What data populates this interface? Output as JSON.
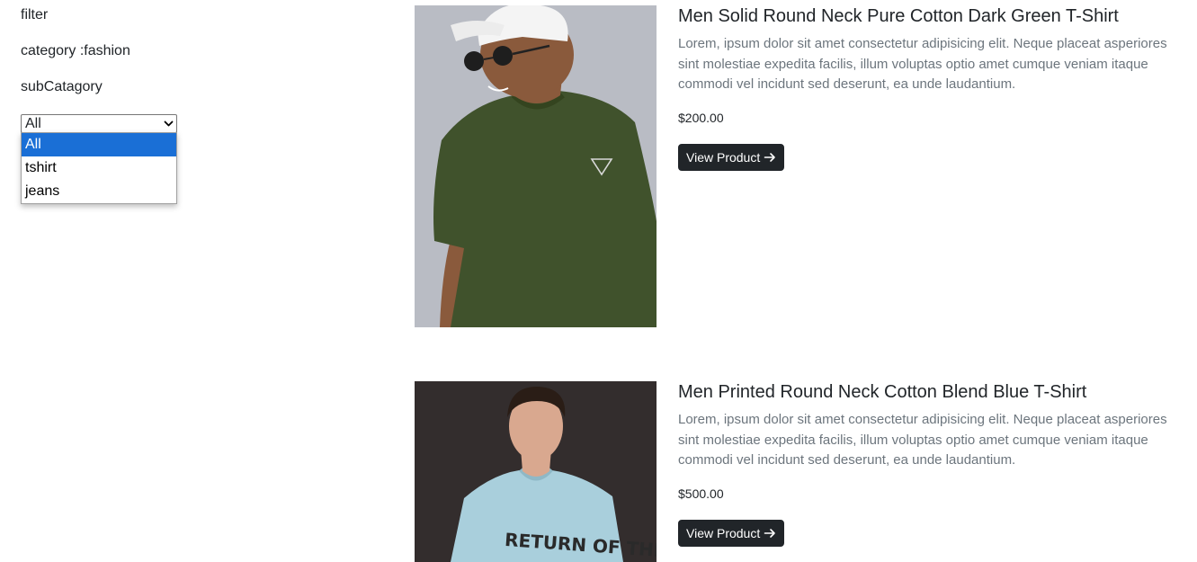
{
  "sidebar": {
    "filter_label": "filter",
    "category_label": "category :fashion",
    "subcategory_label": "subCatagory",
    "select": {
      "value": "All",
      "options": [
        "All",
        "tshirt",
        "jeans"
      ]
    }
  },
  "products": [
    {
      "title": "Men Solid Round Neck Pure Cotton Dark Green T-Shirt",
      "description": "Lorem, ipsum dolor sit amet consectetur adipisicing elit. Neque placeat asperiores sint molestiae expedita facilis, illum voluptas optio amet cumque veniam itaque commodi vel incidunt sed deserunt, ea unde laudantium.",
      "price": "$200.00",
      "button_label": "View Product",
      "image_colors": {
        "background": "#b9bcc4",
        "shirt": "#40522c",
        "skin": "#8a5a3c",
        "cap": "#f4f4f4"
      }
    },
    {
      "title": "Men Printed Round Neck Cotton Blend Blue T-Shirt",
      "description": "Lorem, ipsum dolor sit amet consectetur adipisicing elit. Neque placeat asperiores sint molestiae expedita facilis, illum voluptas optio amet cumque veniam itaque commodi vel incidunt sed deserunt, ea unde laudantium.",
      "price": "$500.00",
      "button_label": "View Product",
      "print_text": "RETURN OF THE",
      "image_colors": {
        "background": "#2f2a2a",
        "shirt": "#a9cfdc",
        "skin": "#d9a88f",
        "hair": "#2a1d16"
      }
    }
  ],
  "colors": {
    "button_bg": "#212529",
    "option_highlight": "#1a6fd6",
    "muted_text": "#6c757d"
  }
}
